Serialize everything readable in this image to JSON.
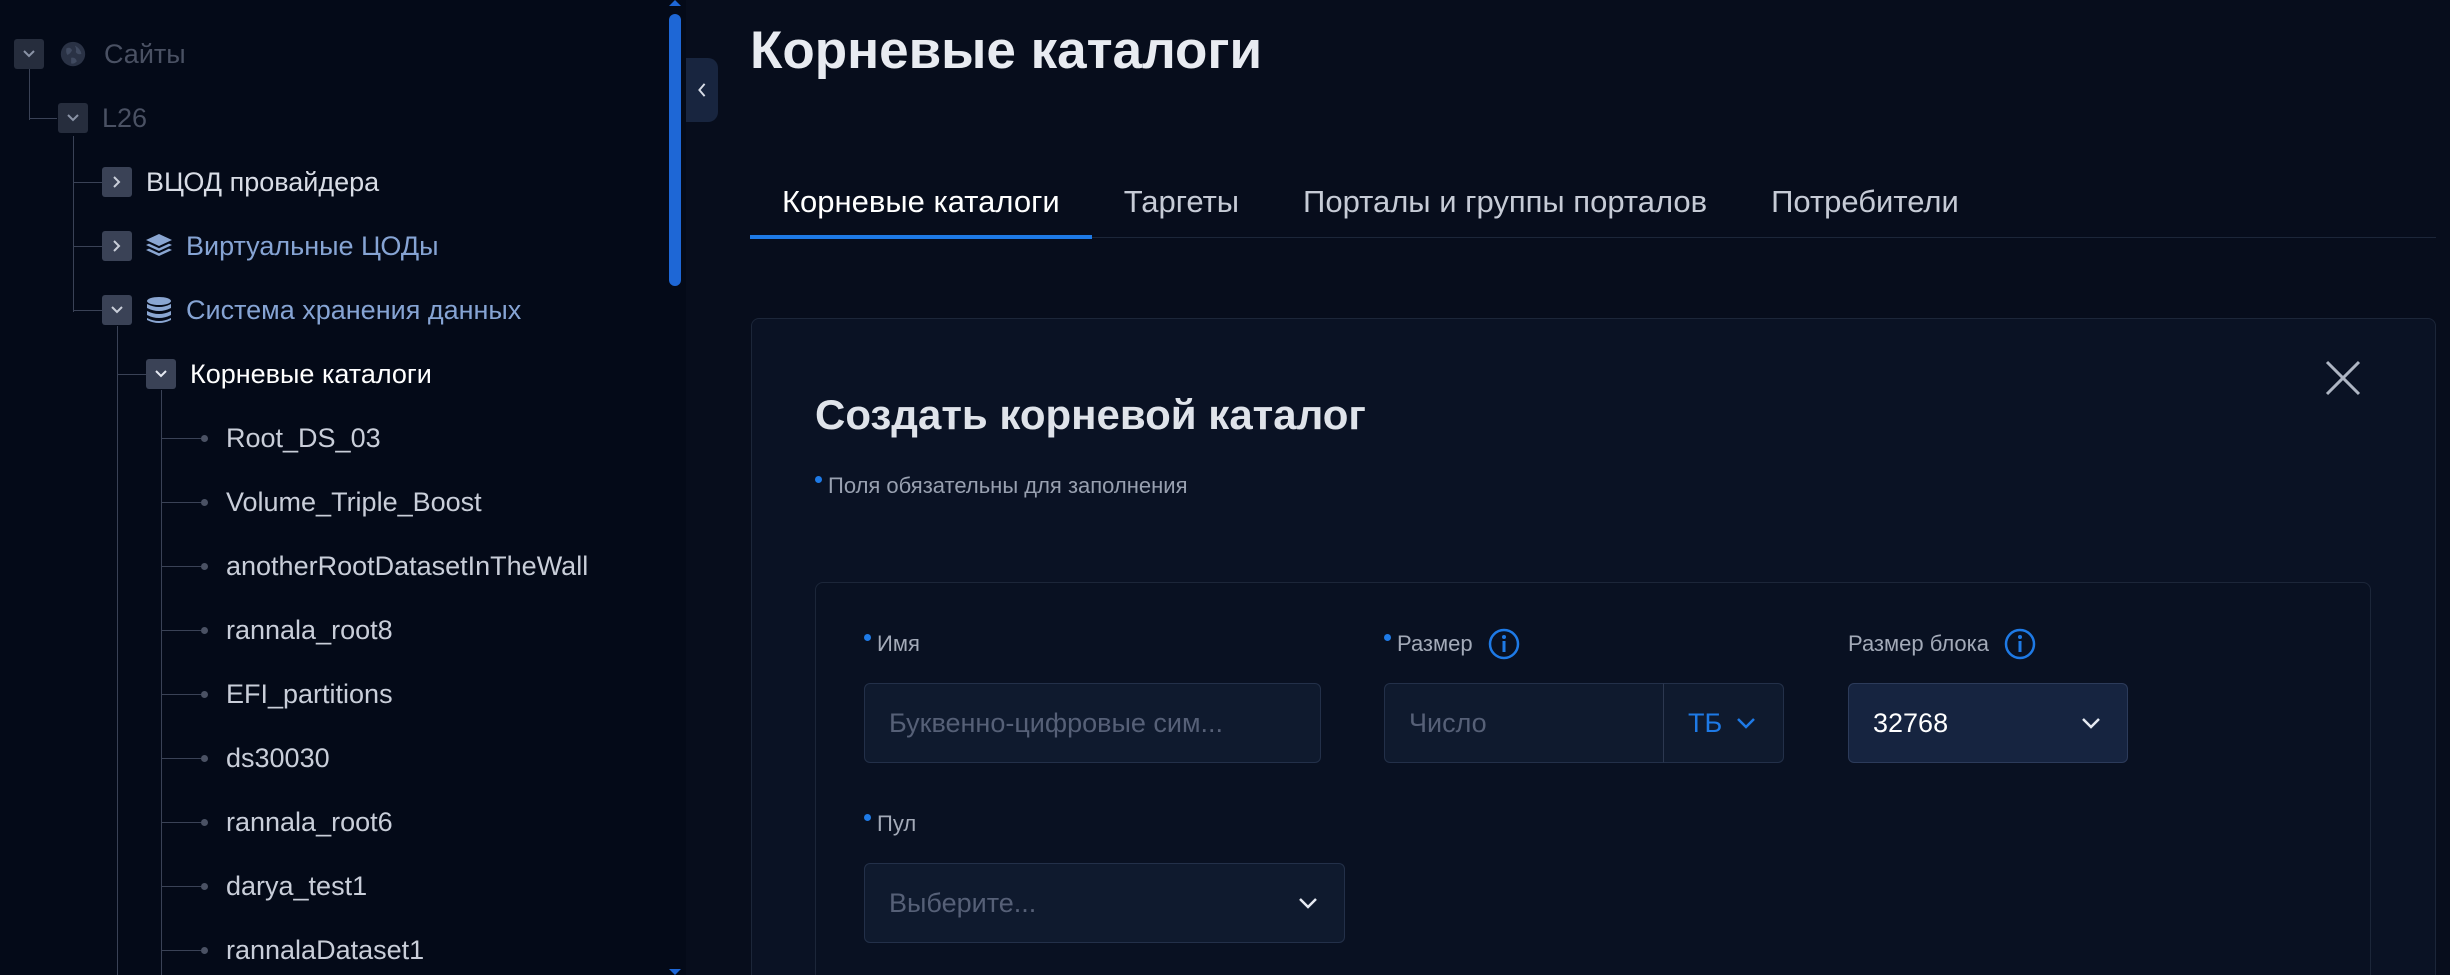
{
  "colors": {
    "accent": "#1e7ae6",
    "background": "#070d1c",
    "sidebar": "#040a18"
  },
  "sidebar": {
    "tree": [
      {
        "label": "Сайты",
        "icon": "globe-icon",
        "state": "expanded"
      },
      {
        "label": "L26",
        "icon": "",
        "state": "expanded"
      },
      {
        "label": "ВЦОД провайдера",
        "icon": "",
        "state": "collapsed"
      },
      {
        "label": "Виртуальные ЦОДы",
        "icon": "layers-icon",
        "state": "collapsed"
      },
      {
        "label": "Система хранения данных",
        "icon": "database-icon",
        "state": "expanded"
      },
      {
        "label": "Корневые каталоги",
        "icon": "",
        "state": "expanded",
        "selected": true
      }
    ],
    "leaves": [
      "Root_DS_03",
      "Volume_Triple_Boost",
      "anotherRootDatasetInTheWall",
      "rannala_root8",
      "EFI_partitions",
      "ds30030",
      "rannala_root6",
      "darya_test1",
      "rannalaDataset1"
    ]
  },
  "main": {
    "title": "Корневые каталоги",
    "tabs": [
      {
        "label": "Корневые каталоги",
        "active": true
      },
      {
        "label": "Таргеты",
        "active": false
      },
      {
        "label": "Порталы и группы порталов",
        "active": false
      },
      {
        "label": "Потребители",
        "active": false
      }
    ]
  },
  "form": {
    "title": "Создать корневой каталог",
    "required_note": "Поля обязательны для заполнения",
    "name": {
      "label": "Имя",
      "placeholder": "Буквенно-цифровые сим...",
      "value": ""
    },
    "size": {
      "label": "Размер",
      "placeholder": "Число",
      "value": "",
      "unit": "ТБ"
    },
    "block_size": {
      "label": "Размер блока",
      "value": "32768"
    },
    "pool": {
      "label": "Пул",
      "placeholder": "Выберите..."
    }
  }
}
